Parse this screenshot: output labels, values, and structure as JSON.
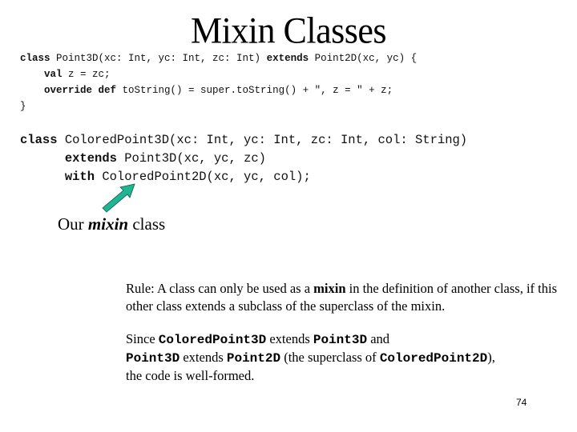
{
  "slide": {
    "title": "Mixin Classes",
    "page_number": "74"
  },
  "code_block_1": {
    "lines": [
      {
        "indent": "",
        "parts": [
          {
            "text": "class",
            "bold": true
          },
          {
            "text": " Point3D(xc: Int, yc: Int, zc: Int) ",
            "bold": false
          },
          {
            "text": "extends",
            "bold": true
          },
          {
            "text": " Point2D(xc, yc) {",
            "bold": false
          }
        ]
      },
      {
        "indent": "    ",
        "parts": [
          {
            "text": "val",
            "bold": true
          },
          {
            "text": " z = zc;",
            "bold": false
          }
        ]
      },
      {
        "indent": "    ",
        "parts": [
          {
            "text": "override def",
            "bold": true
          },
          {
            "text": " toString() = super.toString() + \", z = \" + z;",
            "bold": false
          }
        ]
      },
      {
        "indent": "",
        "parts": [
          {
            "text": "}",
            "bold": false
          }
        ]
      }
    ]
  },
  "code_block_2": {
    "lines": [
      {
        "indent": "",
        "parts": [
          {
            "text": "class",
            "bold": true
          },
          {
            "text": " ColoredPoint3D(xc: Int, yc: Int, zc: Int, col: String)",
            "bold": false
          }
        ]
      },
      {
        "indent": "      ",
        "parts": [
          {
            "text": "extends",
            "bold": true
          },
          {
            "text": " Point3D(xc, yc, zc)",
            "bold": false
          }
        ]
      },
      {
        "indent": "      ",
        "parts": [
          {
            "text": "with",
            "bold": true
          },
          {
            "text": " ColoredPoint2D(xc, yc, col);",
            "bold": false
          }
        ]
      }
    ]
  },
  "annotation": {
    "prefix": "Our ",
    "emphasis": "mixin",
    "suffix": " class",
    "arrow_color": "#1fb592",
    "arrow_icon": "arrow-up-right-icon"
  },
  "rule": {
    "prefix": "Rule:  A class can only be used as a ",
    "bold": "mixin",
    "suffix": " in the definition of another class, if this other class extends a subclass of the superclass of the mixin."
  },
  "since": {
    "segments": [
      {
        "text": "Since ",
        "mono": false
      },
      {
        "text": "ColoredPoint3D",
        "mono": true
      },
      {
        "text": " extends ",
        "mono": false
      },
      {
        "text": "Point3D",
        "mono": true
      },
      {
        "text": " and",
        "mono": false
      },
      {
        "text": "\n",
        "mono": false
      },
      {
        "text": "Point3D",
        "mono": true
      },
      {
        "text": " extends ",
        "mono": false
      },
      {
        "text": "Point2D",
        "mono": true
      },
      {
        "text": " (the superclass of ",
        "mono": false
      },
      {
        "text": "ColoredPoint2D",
        "mono": true
      },
      {
        "text": "),",
        "mono": false
      },
      {
        "text": "\n",
        "mono": false
      },
      {
        "text": "the code is well-formed.",
        "mono": false
      }
    ]
  }
}
